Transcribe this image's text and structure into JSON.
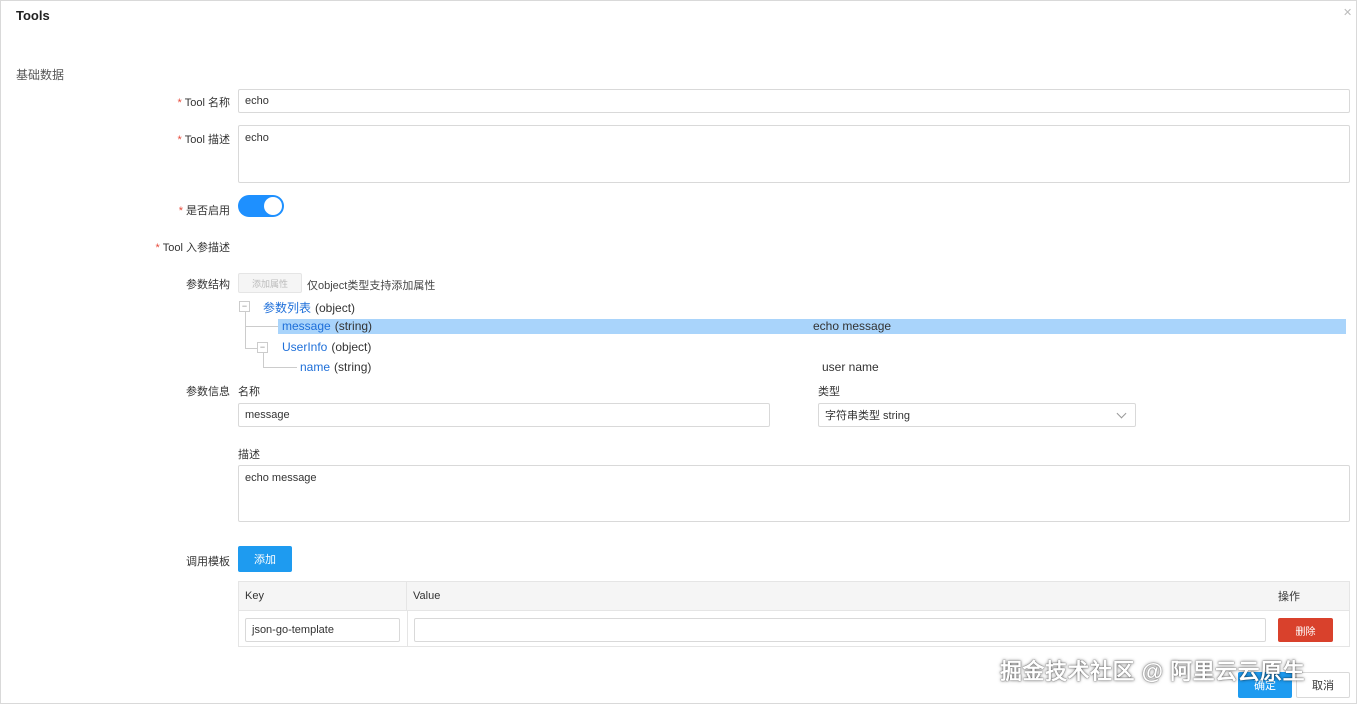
{
  "dialog": {
    "title": "Tools",
    "close_icon": "close-icon"
  },
  "section_title": "基础数据",
  "form": {
    "tool_name": {
      "required_mark": "*",
      "label": "Tool 名称",
      "value": "echo"
    },
    "tool_desc": {
      "required_mark": "*",
      "label": "Tool 描述",
      "value": "echo"
    },
    "enabled": {
      "required_mark": "*",
      "label": "是否启用",
      "on": true
    },
    "params_desc": {
      "required_mark": "*",
      "label": "Tool 入参描述"
    }
  },
  "param_structure": {
    "label": "参数结构",
    "add_attr_button": "添加属性",
    "hint": "仅object类型支持添加属性",
    "tree": {
      "root": {
        "key": "参数列表",
        "type": "(object)",
        "toggle": "−"
      },
      "message": {
        "key": "message",
        "type": "(string)",
        "desc": "echo message"
      },
      "userinfo": {
        "key": "UserInfo",
        "type": "(object)",
        "toggle": "−"
      },
      "name": {
        "key": "name",
        "type": "(string)",
        "desc": "user name"
      }
    }
  },
  "param_info": {
    "label": "参数信息",
    "name_title": "名称",
    "name_value": "message",
    "type_title": "类型",
    "type_value": "字符串类型 string",
    "desc_title": "描述",
    "desc_value": "echo message"
  },
  "template": {
    "label": "调用模板",
    "add_button": "添加",
    "columns": {
      "key": "Key",
      "value": "Value",
      "ops": "操作"
    },
    "rows": [
      {
        "key": "json-go-template",
        "value": "",
        "delete_label": "删除"
      }
    ]
  },
  "footer": {
    "ok": "确定",
    "cancel": "取消"
  },
  "watermark": "掘金技术社区 @ 阿里云云原生",
  "colors": {
    "primary": "#1e9bf0",
    "danger": "#d9412c",
    "selected_row": "#a9d4fb",
    "tree_key": "#1e6fd9",
    "required": "#e74c3c"
  }
}
